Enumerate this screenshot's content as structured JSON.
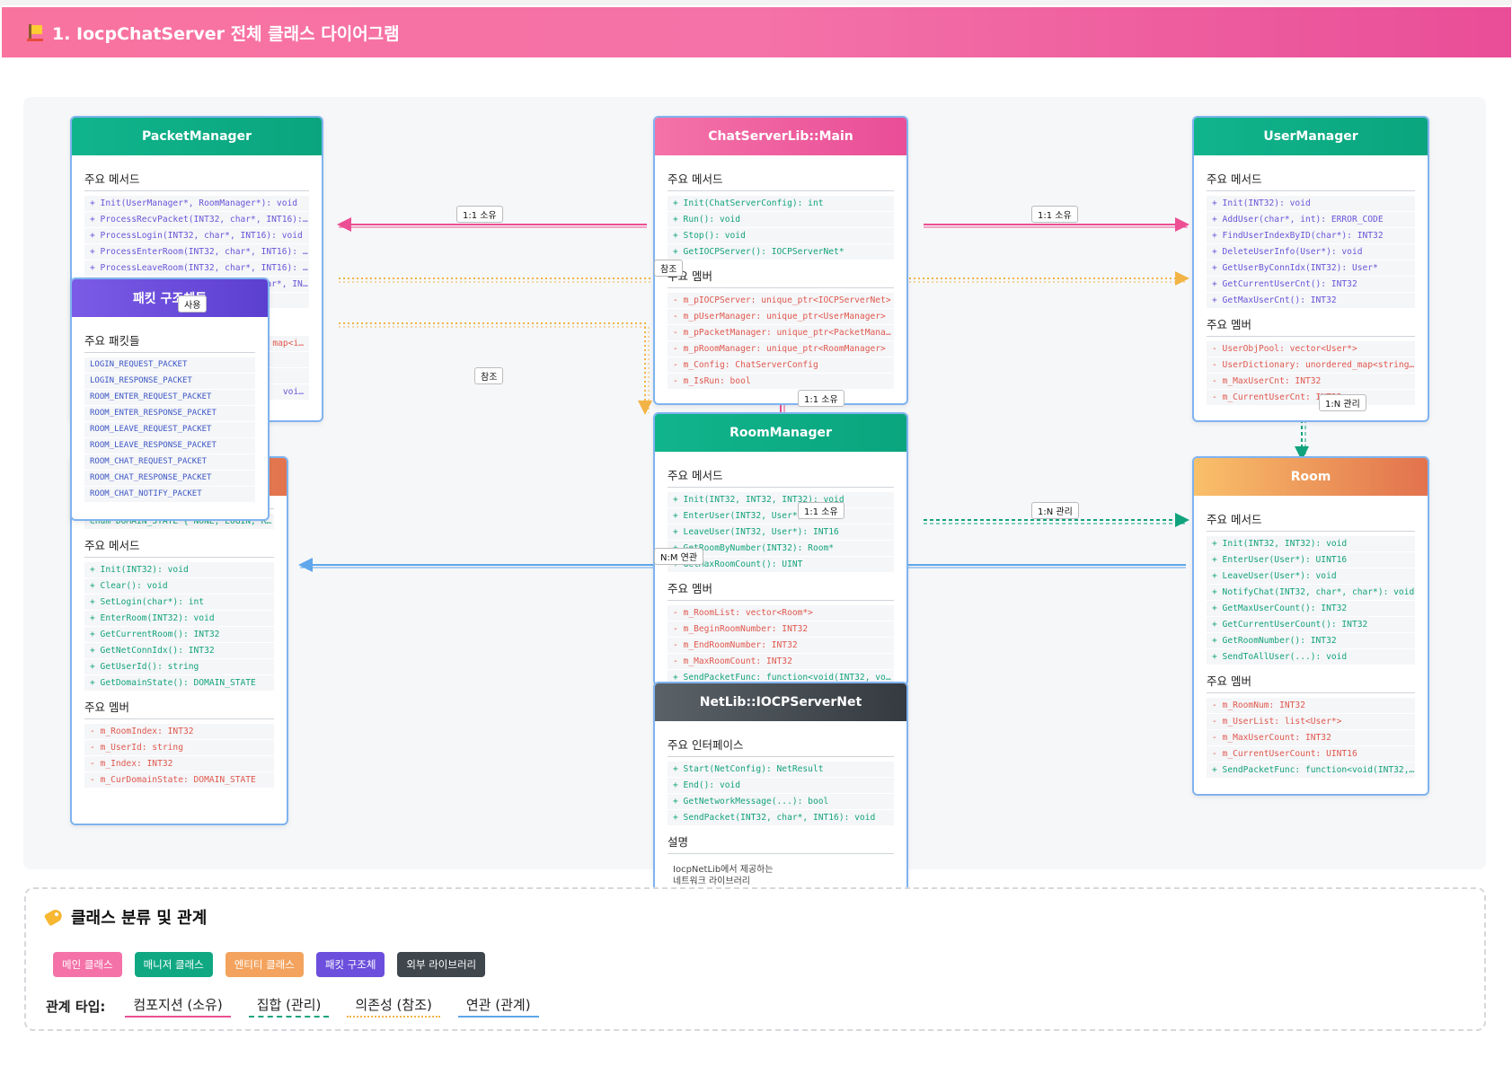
{
  "header": {
    "title": "1. IocpChatServer 전체 클래스 다이어그램",
    "icon": "construction-flag-icon"
  },
  "packet_manager": {
    "title": "PacketManager",
    "methods_label": "주요 메서드",
    "methods": [
      "+ Init(UserManager*, RoomManager*): void",
      "+ ProcessRecvPacket(INT32, char*, INT16): …",
      "+ ProcessLogin(INT32, char*, INT16): void",
      "+ ProcessEnterRoom(INT32, char*, INT16): v…",
      "+ ProcessLeaveRoom(INT32, char*, INT16): v…",
      "+ ProcessRoomChatMessage(INT32, char*, INT…"
    ],
    "members_tail": [
      "map<i…",
      "voi…"
    ]
  },
  "packet_structs": {
    "title": "패킷 구조체들",
    "section_label": "주요 패킷들",
    "items": [
      "LOGIN_REQUEST_PACKET",
      "LOGIN_RESPONSE_PACKET",
      "ROOM_ENTER_REQUEST_PACKET",
      "ROOM_ENTER_RESPONSE_PACKET",
      "ROOM_LEAVE_REQUEST_PACKET",
      "ROOM_LEAVE_RESPONSE_PACKET",
      "ROOM_CHAT_REQUEST_PACKET",
      "ROOM_CHAT_RESPONSE_PACKET",
      "ROOM_CHAT_NOTIFY_PACKET"
    ]
  },
  "user": {
    "enum_row": "enum DOMAIN_STATE { NONE, LOGIN, RO…",
    "methods_label": "주요 메서드",
    "methods": [
      "+ Init(INT32): void",
      "+ Clear(): void",
      "+ SetLogin(char*): int",
      "+ EnterRoom(INT32): void",
      "+ GetCurrentRoom(): INT32",
      "+ GetNetConnIdx(): INT32",
      "+ GetUserId(): string",
      "+ GetDomainState(): DOMAIN_STATE"
    ],
    "members_label": "주요 멤버",
    "members": [
      "- m_RoomIndex: INT32",
      "- m_UserId: string",
      "- m_Index: INT32",
      "- m_CurDomainState: DOMAIN_STATE"
    ]
  },
  "main": {
    "title": "ChatServerLib::Main",
    "methods_label": "주요 메서드",
    "methods": [
      "+ Init(ChatServerConfig): int",
      "+ Run(): void",
      "+ Stop(): void",
      "+ GetIOCPServer(): IOCPServerNet*"
    ],
    "members_label": "주요 멤버",
    "members": [
      "- m_pIOCPServer: unique_ptr<IOCPServerNet>",
      "- m_pUserManager: unique_ptr<UserManager>",
      "- m_pPacketManager: unique_ptr<PacketManag…",
      "- m_pRoomManager: unique_ptr<RoomManager>",
      "- m_Config: ChatServerConfig",
      "- m_IsRun: bool"
    ]
  },
  "room_manager": {
    "title": "RoomManager",
    "methods_label": "주요 메서드",
    "methods": [
      "+ Init(INT32, INT32, INT32): void",
      "+ EnterUser(INT32, User*): INT16",
      "+ LeaveUser(INT32, User*): INT16",
      "+ GetRoomByNumber(INT32): Room*",
      "+ GetMaxRoomCount(): UINT"
    ],
    "members_label": "주요 멤버",
    "members": [
      "- m_RoomList: vector<Room*>",
      "- m_BeginRoomNumber: INT32",
      "- m_EndRoomNumber: INT32",
      "- m_MaxRoomCount: INT32",
      "+ SendPacketFunc: function<void(INT32, voi…"
    ]
  },
  "netlib": {
    "title": "NetLib::IOCPServerNet",
    "interface_label": "주요 인터페이스",
    "methods": [
      "+ Start(NetConfig): NetResult",
      "+ End(): void",
      "+ GetNetworkMessage(...): bool",
      "+ SendPacket(INT32, char*, INT16): void"
    ],
    "desc_label": "설명",
    "desc_line1": "IocpNetLib에서 제공하는",
    "desc_line2": "네트워크 라이브러리"
  },
  "user_manager": {
    "title": "UserManager",
    "methods_label": "주요 메서드",
    "methods": [
      "+ Init(INT32): void",
      "+ AddUser(char*, int): ERROR_CODE",
      "+ FindUserIndexByID(char*): INT32",
      "+ DeleteUserInfo(User*): void",
      "+ GetUserByConnIdx(INT32): User*",
      "+ GetCurrentUserCnt(): INT32",
      "+ GetMaxUserCnt(): INT32"
    ],
    "members_label": "주요 멤버",
    "members": [
      "- UserObjPool: vector<User*>",
      "- UserDictionary: unordered_map<string,…",
      "- m_MaxUserCnt: INT32",
      "- m_CurrentUserCnt: INT32"
    ]
  },
  "room": {
    "title": "Room",
    "methods_label": "주요 메서드",
    "methods": [
      "+ Init(INT32, INT32): void",
      "+ EnterUser(User*): UINT16",
      "+ LeaveUser(User*): void",
      "+ NotifyChat(INT32, char*, char*): void",
      "+ GetMaxUserCount(): INT32",
      "+ GetCurrentUserCount(): INT32",
      "+ GetRoomNumber(): INT32",
      "+ SendToAllUser(...): void"
    ],
    "members_label": "주요 멤버",
    "members": [
      "- m_RoomNum: INT32",
      "- m_UserList: list<User*>",
      "- m_MaxUserCount: INT32",
      "- m_CurrentUserCount: UINT16",
      "+ SendPacketFunc: function<void(INT32, …"
    ]
  },
  "relations": {
    "main_packet": "1:1 소유",
    "main_user": "1:1 소유",
    "main_room_mgr": "1:1 소유",
    "main_net": "1:1 소유",
    "ref_1": "참조",
    "ref_2": "참조",
    "use": "사용",
    "usermgr_room": "1:N 관리",
    "roommgr_room": "1:N 관리",
    "nm": "N:M 연관"
  },
  "legend": {
    "title": "클래스 분류 및 관계",
    "badges": [
      "메인 클래스",
      "매니저 클래스",
      "엔티티 클래스",
      "패킷 구조체",
      "외부 라이브러리"
    ],
    "rel_label": "관계 타입:",
    "rel_types": [
      "컴포지션 (소유)",
      "집합 (관리)",
      "의존성 (참조)",
      "연관 (관계)"
    ]
  },
  "colors": {
    "composition": "#ec4f93",
    "aggregation": "#11a37d",
    "dependency": "#f2b446",
    "association": "#5fa6ea"
  }
}
